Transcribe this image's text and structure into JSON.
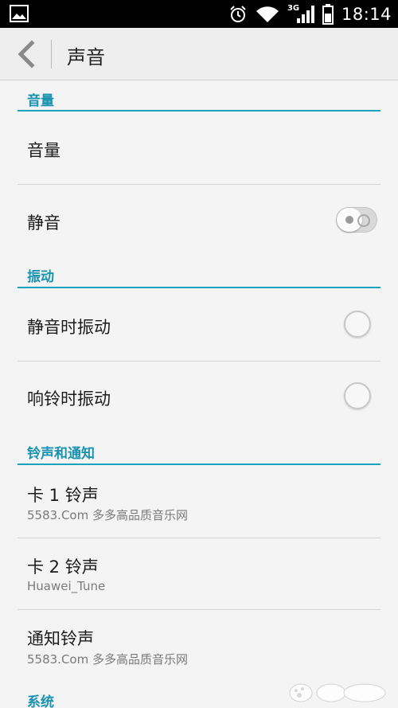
{
  "status_bar": {
    "time": "18:14",
    "network": "3G",
    "icons": [
      "gallery-notification-icon",
      "alarm-icon",
      "wifi-icon",
      "signal-3g-icon",
      "battery-icon"
    ]
  },
  "action_bar": {
    "title": "声音",
    "back_icon": "chevron-left-icon"
  },
  "sections": {
    "volume": {
      "header": "音量",
      "items": {
        "volume": "音量",
        "silent": "静音"
      },
      "silent_on": false
    },
    "vibrate": {
      "header": "振动",
      "items": {
        "vibrate_silent": "静音时振动",
        "vibrate_ring": "响铃时振动"
      },
      "vibrate_silent_checked": false,
      "vibrate_ring_checked": false
    },
    "ringtones": {
      "header": "铃声和通知",
      "card1": {
        "label": "卡 1 铃声",
        "value": "5583.Com 多多高品质音乐网"
      },
      "card2": {
        "label": "卡 2 铃声",
        "value": "Huawei_Tune"
      },
      "notification": {
        "label": "通知铃声",
        "value": "5583.Com 多多高品质音乐网"
      }
    },
    "system": {
      "header": "系统"
    }
  },
  "accent_color": "#1aa1bd"
}
